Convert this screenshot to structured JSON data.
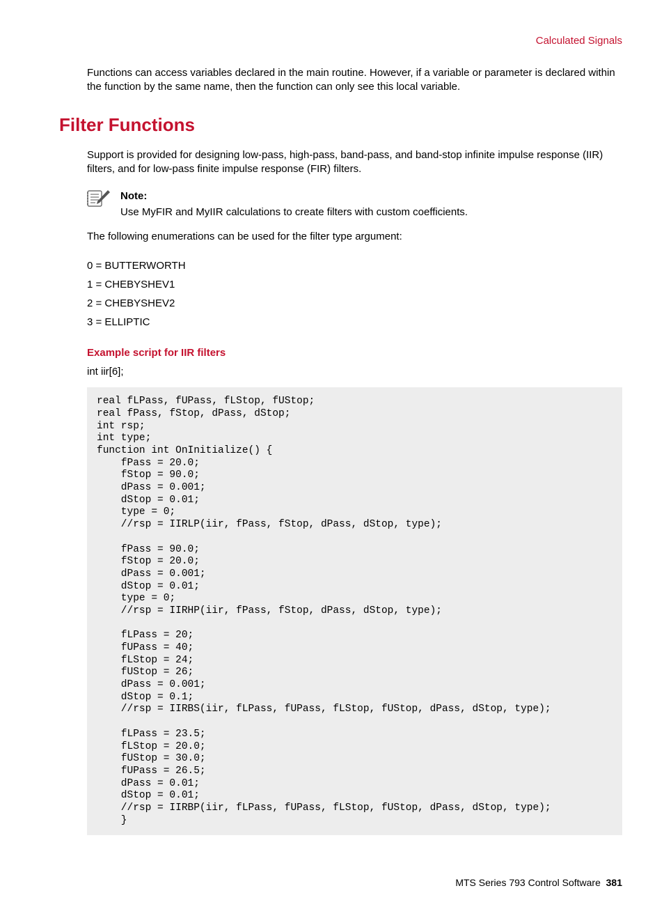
{
  "breadcrumb": "Calculated Signals",
  "intro_para": "Functions can access variables declared in the main routine. However, if a variable or parameter is declared within the function by the same name, then the function can only see this local variable.",
  "section_title": "Filter Functions",
  "support_para": "Support is provided for designing low-pass, high-pass, band-pass, and band-stop infinite impulse response (IIR) filters, and for low-pass finite impulse response (FIR) filters.",
  "note": {
    "label": "Note:",
    "text": "Use MyFIR and MyIIR calculations to create filters with custom coefficients."
  },
  "enum_intro": "The following enumerations can be used for the filter type argument:",
  "enums": [
    "0 = BUTTERWORTH",
    "1 = CHEBYSHEV1",
    "2 = CHEBYSHEV2",
    "3 = ELLIPTIC"
  ],
  "example_heading": "Example script for IIR filters",
  "example_decl": "int iir[6];",
  "code": "real fLPass, fUPass, fLStop, fUStop;\nreal fPass, fStop, dPass, dStop;\nint rsp;\nint type;\nfunction int OnInitialize() {\n    fPass = 20.0;\n    fStop = 90.0;\n    dPass = 0.001;\n    dStop = 0.01;\n    type = 0;\n    //rsp = IIRLP(iir, fPass, fStop, dPass, dStop, type);\n\n    fPass = 90.0;\n    fStop = 20.0;\n    dPass = 0.001;\n    dStop = 0.01;\n    type = 0;\n    //rsp = IIRHP(iir, fPass, fStop, dPass, dStop, type);\n\n    fLPass = 20;\n    fUPass = 40;\n    fLStop = 24;\n    fUStop = 26;\n    dPass = 0.001;\n    dStop = 0.1;\n    //rsp = IIRBS(iir, fLPass, fUPass, fLStop, fUStop, dPass, dStop, type);\n\n    fLPass = 23.5;\n    fLStop = 20.0;\n    fUStop = 30.0;\n    fUPass = 26.5;\n    dPass = 0.01;\n    dStop = 0.01;\n    //rsp = IIRBP(iir, fLPass, fUPass, fLStop, fUStop, dPass, dStop, type);\n    }",
  "footer": {
    "text": "MTS Series 793 Control Software",
    "page": "381"
  }
}
